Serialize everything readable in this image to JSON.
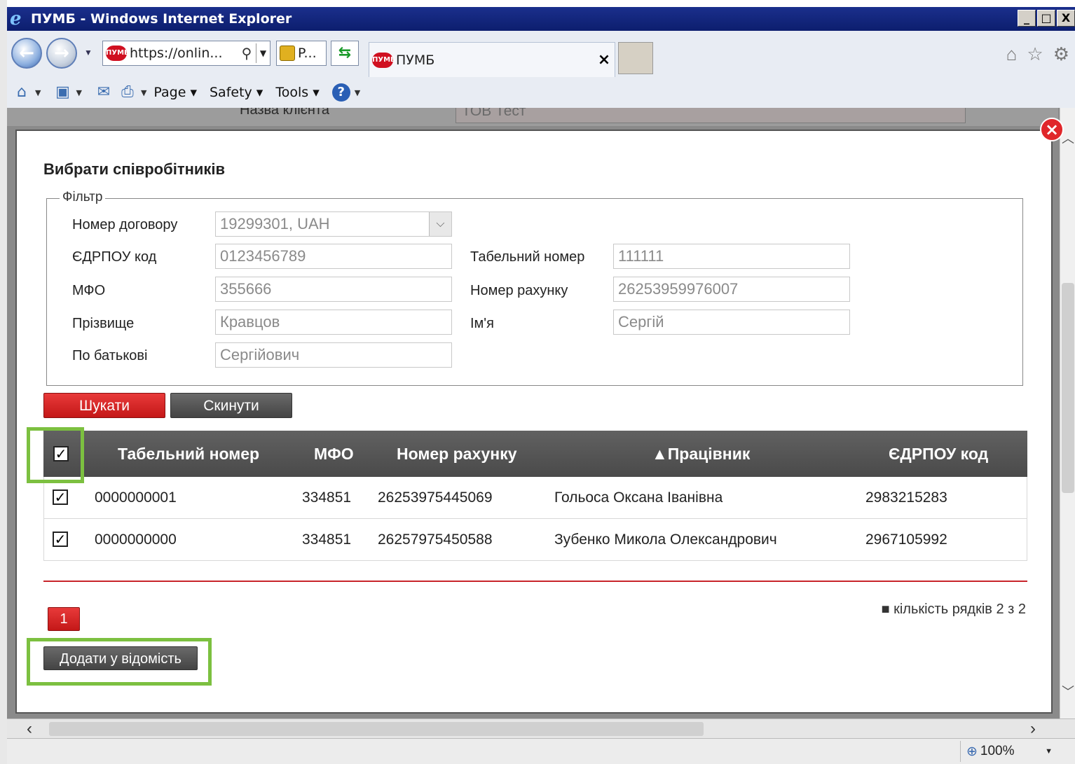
{
  "window": {
    "title": "ПУМБ - Windows Internet Explorer",
    "buttons": [
      "_",
      "□",
      "X"
    ]
  },
  "nav": {
    "url": "https://onlin...",
    "security_label": "P...",
    "tab_title": "ПУМБ",
    "site_badge": "ПУМБ"
  },
  "cmdbar": {
    "items": [
      "Page",
      "Safety",
      "Tools"
    ]
  },
  "background": {
    "label": "Назва клієнта",
    "value": "ТОВ Тест"
  },
  "modal": {
    "title": "Вибрати співробітників",
    "filter": {
      "legend": "Фільтр",
      "contract_label": "Номер договору",
      "contract_value": "19299301, UAH",
      "edrpou_label": "ЄДРПОУ код",
      "edrpou_value": "0123456789",
      "mfo_label": "МФО",
      "mfo_value": "355666",
      "surname_label": "Прізвище",
      "surname_value": "Кравцов",
      "patronymic_label": "По батькові",
      "patronymic_value": "Сергійович",
      "tab_number_label": "Табельний номер",
      "tab_number_value": "111111",
      "account_label": "Номер рахунку",
      "account_value": "26253959976007",
      "name_label": "Ім'я",
      "name_value": "Сергій"
    },
    "search_button": "Шукати",
    "reset_button": "Скинути",
    "table": {
      "headers": {
        "tab_number": "Табельний номер",
        "mfo": "МФО",
        "account": "Номер рахунку",
        "employee": "▲Працівник",
        "edrpou": "ЄДРПОУ код"
      },
      "header_checked": true,
      "rows": [
        {
          "checked": true,
          "tab_number": "0000000001",
          "mfo": "334851",
          "account": "26253975445069",
          "employee": "Гольоса Оксана Іванівна",
          "edrpou": "2983215283"
        },
        {
          "checked": true,
          "tab_number": "0000000000",
          "mfo": "334851",
          "account": "26257975450588",
          "employee": "Зубенко Микола Олександрович",
          "edrpou": "2967105992"
        }
      ]
    },
    "pagination": {
      "current_page": "1",
      "row_count_text": "■ кількість рядків 2 з 2"
    },
    "add_button": "Додати у відомість"
  },
  "status": {
    "zoom": "100%"
  },
  "colors": {
    "accent_red": "#c41818",
    "highlight_green": "#7cc040",
    "header_dark": "#4a4a4a"
  }
}
